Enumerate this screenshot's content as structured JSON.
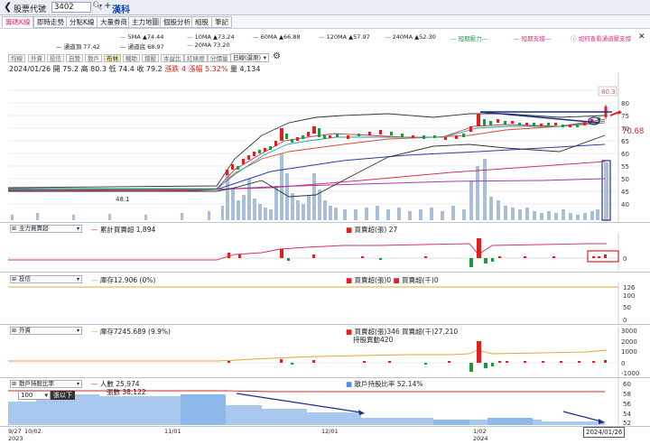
{
  "header": {
    "back_icon": "chevron-left-icon",
    "stock_code_label": "股票代號",
    "stock_code_value": "3402",
    "stock_name": "漢科"
  },
  "tabs": [
    "籌碼K線",
    "即時走勢",
    "分點K線",
    "大量券商",
    "主力地圖",
    "個股分析",
    "組股",
    "筆記"
  ],
  "ma_legend": {
    "row1": [
      {
        "text": "5MA ▲74.44",
        "color": "#d83060"
      },
      {
        "text": "10MA ▲73.24",
        "color": "#1fa3a3"
      },
      {
        "text": "60MA ▲66.88",
        "color": "#2b3cae"
      },
      {
        "text": "120MA ▲57.97",
        "color": "#d83060"
      },
      {
        "text": "240MA ▲52.30",
        "color": "#9a3fb0"
      },
      {
        "text": "短期壓力---",
        "color": "#1f9a4a"
      },
      {
        "text": "短期支撐---",
        "color": "#d8327a"
      }
    ],
    "row2": [
      {
        "text": "通道頂 77.42",
        "color": "#333333"
      },
      {
        "text": "通道底 68.97",
        "color": "#333333"
      },
      {
        "text": "20MA 73.20",
        "color": "#d84a2a"
      }
    ],
    "help_text": "如何查看通道壓支撐"
  },
  "toolbar": [
    "均線",
    "外資",
    "投信",
    "自營",
    "散戶",
    "布林",
    "輔助",
    "撐壓",
    "本益比",
    "紅綠燈",
    "分價量"
  ],
  "toolbar_active": 5,
  "period_select": "日線(還原)",
  "quote": {
    "date": "2024/01/26",
    "open": "開 75.2",
    "high": "高 80.3",
    "low": "低 74.4",
    "close": "收 79.2",
    "change": "漲跌 4",
    "pct": "漲幅 5.32%",
    "volume": "量 4,134"
  },
  "price_chart": {
    "y_ticks": [
      "80",
      "75",
      "70",
      "65",
      "60",
      "55",
      "50",
      "45",
      "40"
    ],
    "high_badge": "80.3",
    "right_price": "70.68",
    "low_label": "48.1"
  },
  "panels": {
    "main_force": {
      "select": "主力買賣超",
      "left": "累計買賣超 1,894",
      "right": "買賣超(張) 27",
      "y_ticks": [
        "0"
      ]
    },
    "trust": {
      "select": "投信",
      "left": "庫存12.906 (0%)",
      "right1": "買賣超(張)0",
      "right2": "買賣超(千)0",
      "y_ticks": [
        "126",
        "100",
        "50",
        "0"
      ]
    },
    "foreign": {
      "select": "外資",
      "left": "庫存7245.689 (9.9%)",
      "right1": "買賣超(張)346",
      "right2": "買賣超(千)27,210",
      "right3": "持股異動420",
      "y_ticks": [
        "3000",
        "2000",
        "1000",
        "0",
        "-1000"
      ]
    },
    "retail": {
      "select": "散戶持股比率",
      "left1": "人數 25,974",
      "left2": "張數 38,122",
      "right": "散戶持股比率 52.14%",
      "y_ticks": [
        "60",
        "58",
        "56",
        "54",
        "52"
      ],
      "lot_value": "100",
      "lot_label": "張以下"
    }
  },
  "x_axis": {
    "labels": [
      {
        "top": "9/27",
        "bottom": "2023"
      },
      {
        "top": "10/02",
        "bottom": ""
      },
      {
        "top": "11/01",
        "bottom": ""
      },
      {
        "top": "12/01",
        "bottom": ""
      },
      {
        "top": "1/02",
        "bottom": "2024"
      }
    ],
    "current_date": "2024/01/26"
  }
}
